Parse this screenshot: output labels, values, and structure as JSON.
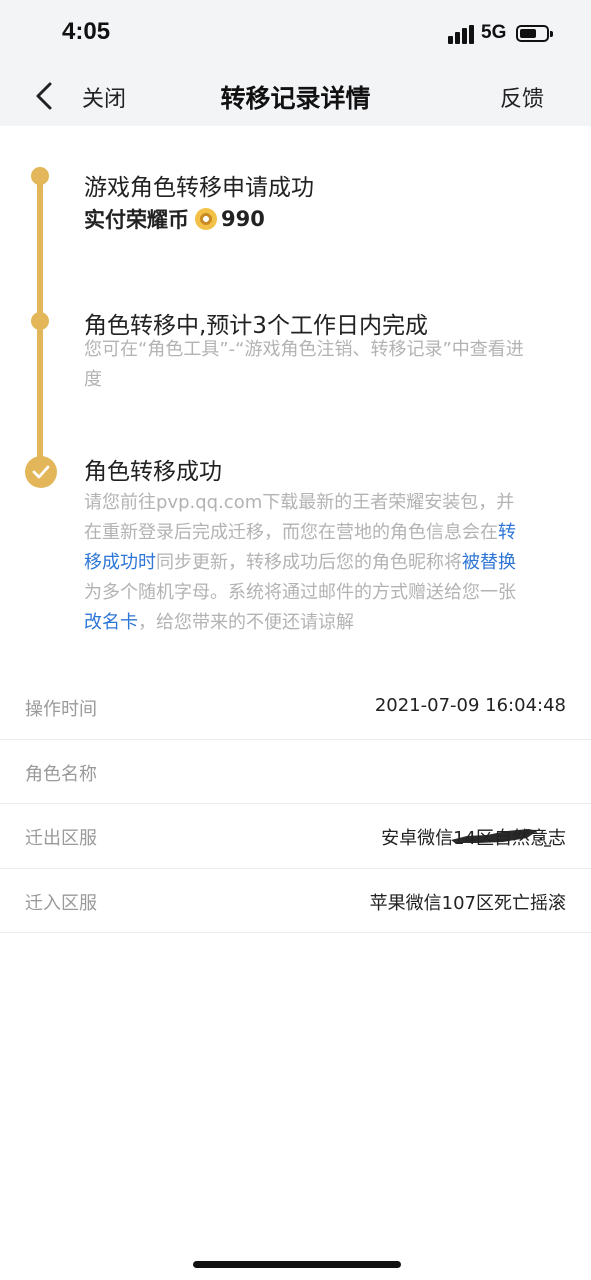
{
  "status": {
    "time": "4:05",
    "network": "5G"
  },
  "nav": {
    "close_label": "关闭",
    "title": "转移记录详情",
    "feedback_label": "反馈"
  },
  "timeline": {
    "step1": {
      "title": "游戏角色转移申请成功",
      "paid_label": "实付荣耀币",
      "paid_amount": "990"
    },
    "step2": {
      "title": "角色转移中,预计3个工作日内完成",
      "desc": "您可在“角色工具”-“游戏角色注销、转移记录”中查看进度"
    },
    "step3": {
      "title": "角色转移成功",
      "desc_parts": {
        "p1": "请您前往pvp.qq.com下载最新的王者荣耀安装包，并在重新登录后完成迁移，而您在营地的角色信息会在",
        "h1": "转移成功时",
        "p2": "同步更新，转移成功后您的角色昵称将",
        "h2": "被替换",
        "p3": "为多个随机字母。系统将通过邮件的方式赠送给您一张",
        "h3": "改名卡",
        "p4": "，给您带来的不便还请谅解"
      }
    }
  },
  "info": {
    "rows": [
      {
        "key": "操作时间",
        "value": "2021-07-09 16:04:48"
      },
      {
        "key": "角色名称",
        "value": ""
      },
      {
        "key": "迁出区服",
        "value": "安卓微信14区自然意志"
      },
      {
        "key": "迁入区服",
        "value": "苹果微信107区死亡摇滚"
      }
    ]
  },
  "colors": {
    "accent": "#e3b65a",
    "link": "#2e76d6",
    "muted": "#b3b3b3"
  }
}
